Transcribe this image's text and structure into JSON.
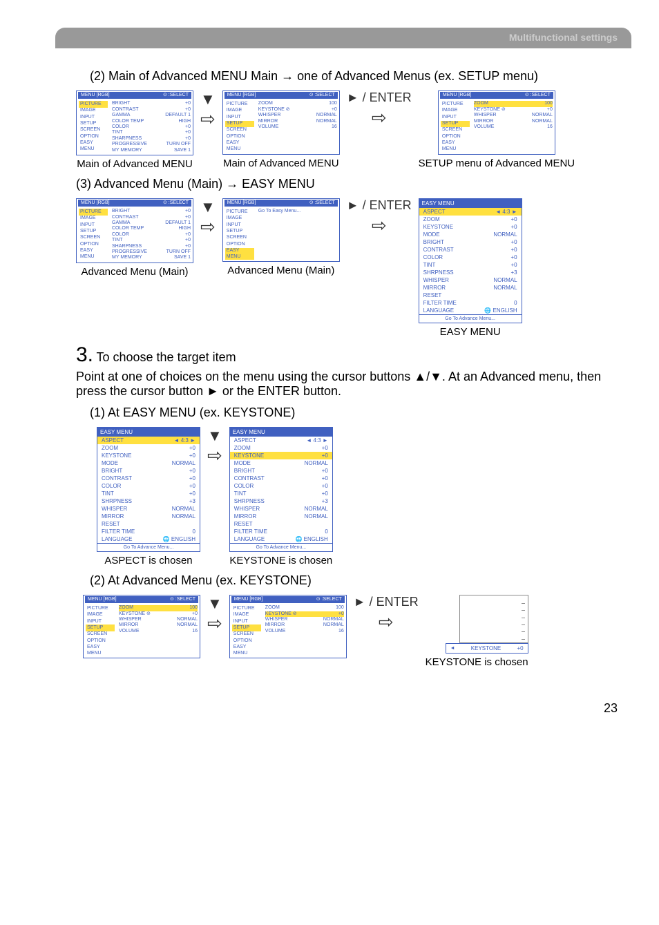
{
  "header": {
    "title": "Multifunctional settings"
  },
  "section2": {
    "title": "(2) Main of Advanced MENU Main → one of Advanced Menus (ex. SETUP menu)",
    "menu1": {
      "headerLeft": "MENU [RGB]",
      "headerRight": "⊙ :SELECT",
      "leftItems": [
        "PICTURE",
        "IMAGE",
        "INPUT",
        "SETUP",
        "SCREEN",
        "OPTION",
        "EASY MENU"
      ],
      "hlIndex": 0,
      "rows": [
        [
          "BRIGHT",
          "+0"
        ],
        [
          "CONTRAST",
          "+0"
        ],
        [
          "GAMMA",
          "DEFAULT 1"
        ],
        [
          "COLOR TEMP",
          "HIGH"
        ],
        [
          "COLOR",
          "+0"
        ],
        [
          "TINT",
          "+0"
        ],
        [
          "SHARPNESS",
          "+0"
        ],
        [
          "PROGRESSIVE",
          "TURN OFF"
        ],
        [
          "MY MEMORY",
          "SAVE 1"
        ]
      ],
      "caption": "Main of Advanced MENU"
    },
    "arrow1": "▼",
    "arrowR": "⇨",
    "menu2": {
      "headerLeft": "MENU [RGB]",
      "headerRight": "⊙ :SELECT",
      "leftItems": [
        "PICTURE",
        "IMAGE",
        "INPUT",
        "SETUP",
        "SCREEN",
        "OPTION",
        "EASY MENU"
      ],
      "hlIndex": 3,
      "rows": [
        [
          "ZOOM",
          "100"
        ],
        [
          "KEYSTONE ⊘",
          "+0"
        ],
        [
          "WHISPER",
          "NORMAL"
        ],
        [
          "MIRROR",
          "NORMAL"
        ],
        [
          "VOLUME",
          "16"
        ]
      ],
      "caption": "Main of Advanced MENU"
    },
    "enter": "► / ENTER",
    "menu3": {
      "headerLeft": "MENU [RGB]",
      "headerRight": "⊙ :SELECT",
      "leftItems": [
        "PICTURE",
        "IMAGE",
        "INPUT",
        "SETUP",
        "SCREEN",
        "OPTION",
        "EASY MENU"
      ],
      "hlIndex": 3,
      "rows": [
        [
          "ZOOM",
          "100"
        ],
        [
          "KEYSTONE ⊘",
          "+0"
        ],
        [
          "WHISPER",
          "NORMAL"
        ],
        [
          "MIRROR",
          "NORMAL"
        ],
        [
          "VOLUME",
          "16"
        ]
      ],
      "hlRow": 0,
      "caption": "SETUP menu of Advanced MENU"
    }
  },
  "section3": {
    "title": "(3) Advanced Menu (Main) → EASY MENU",
    "menu1": {
      "headerLeft": "MENU [RGB]",
      "headerRight": "⊙ :SELECT",
      "leftItems": [
        "PICTURE",
        "IMAGE",
        "INPUT",
        "SETUP",
        "SCREEN",
        "OPTION",
        "EASY MENU"
      ],
      "hlIndex": 0,
      "rows": [
        [
          "BRIGHT",
          "+0"
        ],
        [
          "CONTRAST",
          "+0"
        ],
        [
          "GAMMA",
          "DEFAULT 1"
        ],
        [
          "COLOR TEMP",
          "HIGH"
        ],
        [
          "COLOR",
          "+0"
        ],
        [
          "TINT",
          "+0"
        ],
        [
          "SHARPNESS",
          "+0"
        ],
        [
          "PROGRESSIVE",
          "TURN OFF"
        ],
        [
          "MY MEMORY",
          "SAVE 1"
        ]
      ],
      "caption": "Advanced Menu (Main)"
    },
    "arrow1": "▼",
    "arrowR": "⇨",
    "menu2": {
      "headerLeft": "MENU [RGB]",
      "headerRight": "⊙ :SELECT",
      "leftItems": [
        "PICTURE",
        "IMAGE",
        "INPUT",
        "SETUP",
        "SCREEN",
        "OPTION",
        "EASY MENU"
      ],
      "hlIndex": 6,
      "rightText": "Go To Easy Menu...",
      "caption": "Advanced Menu (Main)"
    },
    "enter": "► / ENTER",
    "easyMenu": {
      "header": "EASY MENU",
      "rows": [
        [
          "ASPECT",
          "◄   4:3   ►",
          "hl"
        ],
        [
          "ZOOM",
          "+0",
          ""
        ],
        [
          "KEYSTONE",
          "+0",
          ""
        ],
        [
          "MODE",
          "NORMAL",
          ""
        ],
        [
          "BRIGHT",
          "+0",
          ""
        ],
        [
          "CONTRAST",
          "+0",
          ""
        ],
        [
          "COLOR",
          "+0",
          ""
        ],
        [
          "TINT",
          "+0",
          ""
        ],
        [
          "SHRPNESS",
          "+3",
          ""
        ],
        [
          "WHISPER",
          "NORMAL",
          ""
        ],
        [
          "MIRROR",
          "NORMAL",
          ""
        ],
        [
          "RESET",
          "",
          ""
        ],
        [
          "FILTER TIME",
          "0",
          ""
        ],
        [
          "LANGUAGE",
          "🌐    ENGLISH",
          ""
        ]
      ],
      "footer": "Go To Advance Menu...",
      "caption": "EASY MENU"
    }
  },
  "step3": {
    "num": "3.",
    "line1": "To choose the target item",
    "body": "Point at one of choices on the menu using the cursor buttons ▲/▼. At an Advanced menu, then press the cursor button ► or the ENTER button."
  },
  "section3_1": {
    "title": "(1) At EASY MENU (ex. KEYSTONE)",
    "easy1": {
      "header": "EASY MENU",
      "rows": [
        [
          "ASPECT",
          "◄   4:3   ►",
          "hl"
        ],
        [
          "ZOOM",
          "+0",
          ""
        ],
        [
          "KEYSTONE",
          "+0",
          ""
        ],
        [
          "MODE",
          "NORMAL",
          ""
        ],
        [
          "BRIGHT",
          "+0",
          ""
        ],
        [
          "CONTRAST",
          "+0",
          ""
        ],
        [
          "COLOR",
          "+0",
          ""
        ],
        [
          "TINT",
          "+0",
          ""
        ],
        [
          "SHRPNESS",
          "+3",
          ""
        ],
        [
          "WHISPER",
          "NORMAL",
          ""
        ],
        [
          "MIRROR",
          "NORMAL",
          ""
        ],
        [
          "RESET",
          "",
          ""
        ],
        [
          "FILTER TIME",
          "0",
          ""
        ],
        [
          "LANGUAGE",
          "🌐    ENGLISH",
          ""
        ]
      ],
      "footer": "Go To Advance Menu...",
      "caption": "ASPECT is chosen"
    },
    "arrow1": "▼",
    "arrowR": "⇨",
    "easy2": {
      "header": "EASY MENU",
      "rows": [
        [
          "ASPECT",
          "◄   4:3   ►",
          ""
        ],
        [
          "ZOOM",
          "+0",
          ""
        ],
        [
          "KEYSTONE",
          "+0",
          "hl"
        ],
        [
          "MODE",
          "NORMAL",
          ""
        ],
        [
          "BRIGHT",
          "+0",
          ""
        ],
        [
          "CONTRAST",
          "+0",
          ""
        ],
        [
          "COLOR",
          "+0",
          ""
        ],
        [
          "TINT",
          "+0",
          ""
        ],
        [
          "SHRPNESS",
          "+3",
          ""
        ],
        [
          "WHISPER",
          "NORMAL",
          ""
        ],
        [
          "MIRROR",
          "NORMAL",
          ""
        ],
        [
          "RESET",
          "",
          ""
        ],
        [
          "FILTER TIME",
          "0",
          ""
        ],
        [
          "LANGUAGE",
          "🌐    ENGLISH",
          ""
        ]
      ],
      "footer": "Go To Advance Menu...",
      "caption": "KEYSTONE is chosen"
    }
  },
  "section3_2": {
    "title": "(2) At Advanced Menu (ex. KEYSTONE)",
    "menu1": {
      "headerLeft": "MENU [RGB]",
      "headerRight": "⊙ :SELECT",
      "leftItems": [
        "PICTURE",
        "IMAGE",
        "INPUT",
        "SETUP",
        "SCREEN",
        "OPTION",
        "EASY MENU"
      ],
      "hlIndex": 3,
      "rows": [
        [
          "ZOOM",
          "100"
        ],
        [
          "KEYSTONE ⊘",
          "+0"
        ],
        [
          "WHISPER",
          "NORMAL"
        ],
        [
          "MIRROR",
          "NORMAL"
        ],
        [
          "VOLUME",
          "16"
        ]
      ],
      "hlRow": 0
    },
    "arrow1": "▼",
    "arrowR": "⇨",
    "menu2": {
      "headerLeft": "MENU [RGB]",
      "headerRight": "⊙ :SELECT",
      "leftItems": [
        "PICTURE",
        "IMAGE",
        "INPUT",
        "SETUP",
        "SCREEN",
        "OPTION",
        "EASY MENU"
      ],
      "hlIndex": 3,
      "rows": [
        [
          "ZOOM",
          "100"
        ],
        [
          "KEYSTONE ⊘",
          "+0"
        ],
        [
          "WHISPER",
          "NORMAL"
        ],
        [
          "MIRROR",
          "NORMAL"
        ],
        [
          "VOLUME",
          "16"
        ]
      ],
      "hlRow": 1
    },
    "enter": "► / ENTER",
    "popup": {
      "label": "KEYSTONE",
      "value": "+0",
      "caption": "KEYSTONE is chosen"
    }
  },
  "pageNum": "23"
}
